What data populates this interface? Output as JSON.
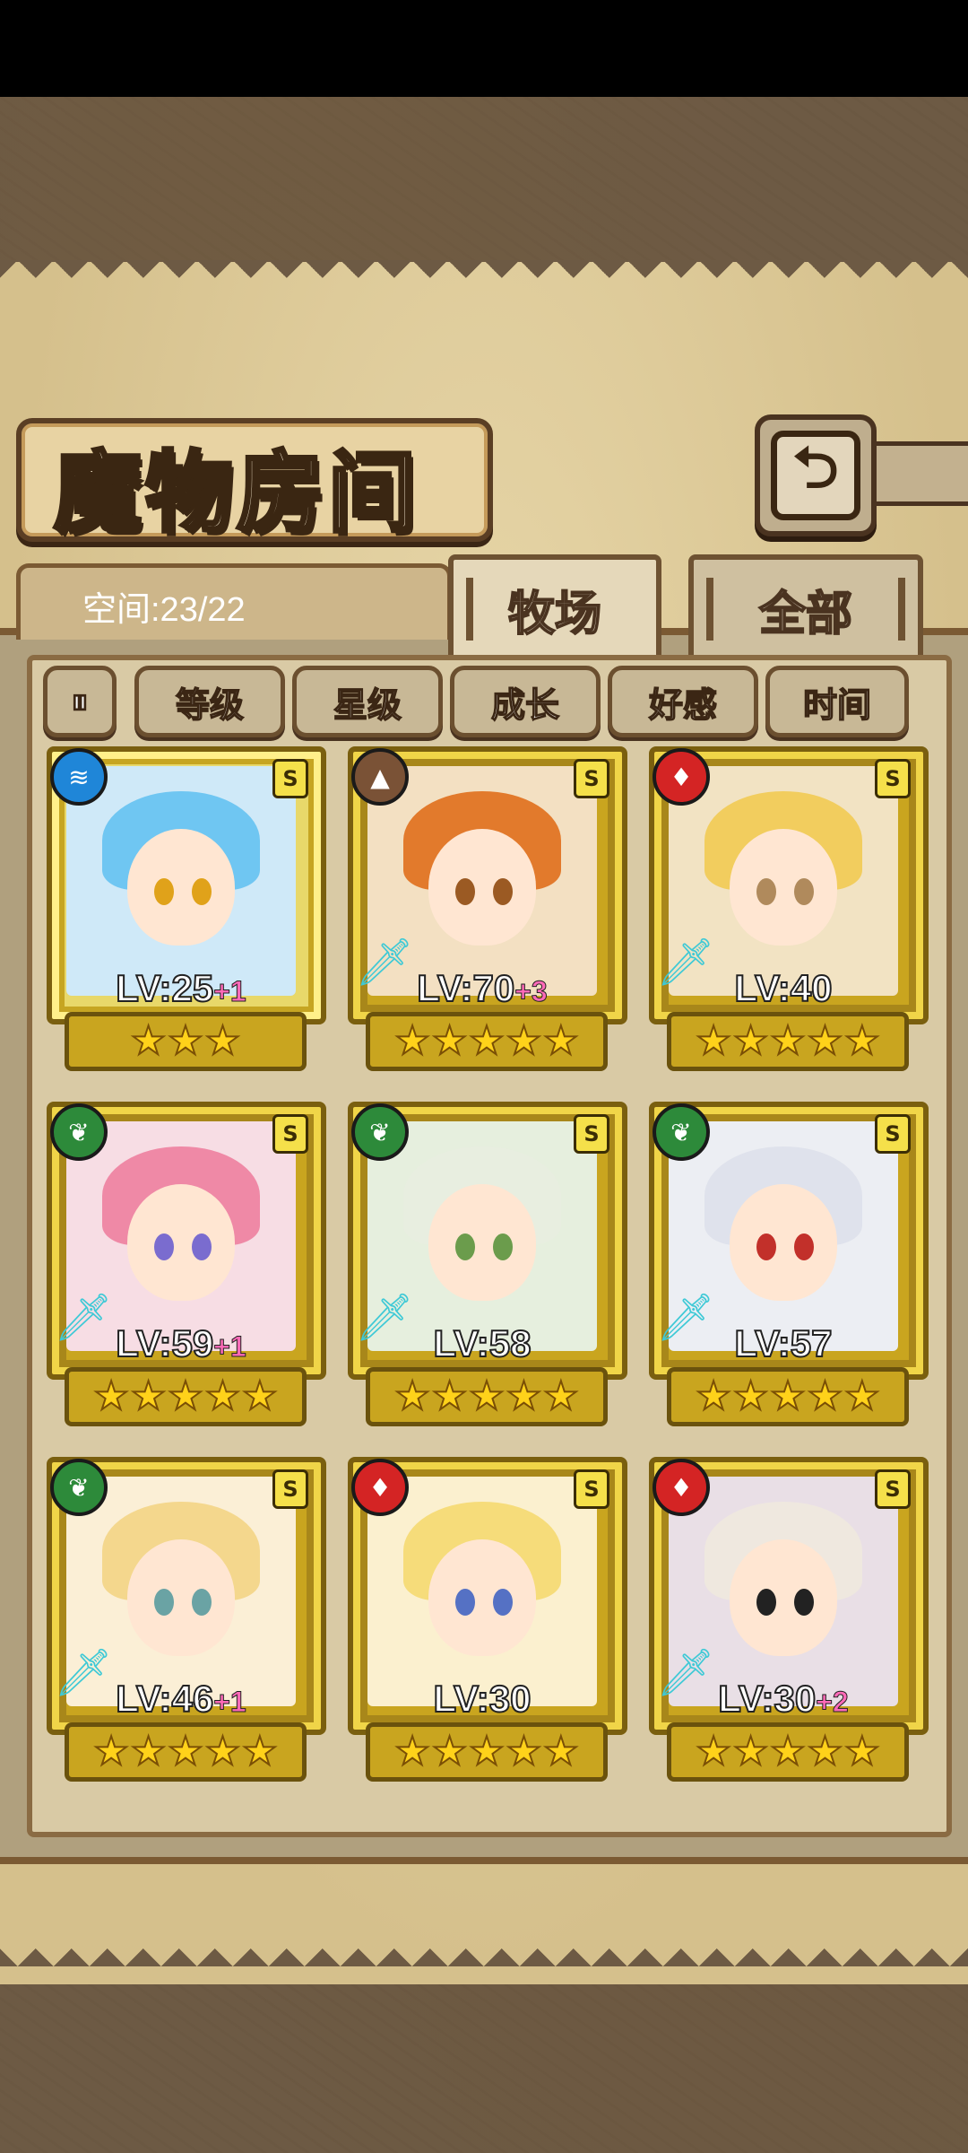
{
  "title": "魔物房间",
  "back_icon": "⮌",
  "space": {
    "label": "空间:23/22"
  },
  "tabs": [
    {
      "label": "牧场",
      "active": true
    },
    {
      "label": "全部",
      "active": false
    }
  ],
  "sort_toggle_icon": "⏸",
  "filters": [
    "等级",
    "星级",
    "成长",
    "好感",
    "时间"
  ],
  "colors": {
    "water": "#1f86d8",
    "earth": "#7a5236",
    "fire": "#d42424",
    "nature": "#2d8a3a"
  },
  "monsters": [
    {
      "element": "water",
      "element_icon": "≋",
      "rank": "S",
      "level": "LV:25",
      "bonus": "+1",
      "stars": 3,
      "selected": true,
      "weapon": false,
      "hair": "#6fc6f2",
      "eye": "#e0a21a",
      "bg": "#cfe9f8"
    },
    {
      "element": "earth",
      "element_icon": "▲",
      "rank": "S",
      "level": "LV:70",
      "bonus": "+3",
      "stars": 5,
      "selected": false,
      "weapon": true,
      "hair": "#e27a2c",
      "eye": "#9b5a23",
      "bg": "#f3e0c2"
    },
    {
      "element": "fire",
      "element_icon": "♦",
      "rank": "S",
      "level": "LV:40",
      "bonus": "",
      "stars": 5,
      "selected": false,
      "weapon": true,
      "hair": "#f2cd5e",
      "eye": "#b08a5c",
      "bg": "#f2e3c3"
    },
    {
      "element": "nature",
      "element_icon": "❦",
      "rank": "S",
      "level": "LV:59",
      "bonus": "+1",
      "stars": 5,
      "selected": false,
      "weapon": true,
      "hair": "#ef89a6",
      "eye": "#7a6ccf",
      "bg": "#f7dde4"
    },
    {
      "element": "nature",
      "element_icon": "❦",
      "rank": "S",
      "level": "LV:58",
      "bonus": "",
      "stars": 5,
      "selected": false,
      "weapon": true,
      "hair": "#e8eee0",
      "eye": "#6b9c4c",
      "bg": "#e6efde"
    },
    {
      "element": "nature",
      "element_icon": "❦",
      "rank": "S",
      "level": "LV:57",
      "bonus": "",
      "stars": 5,
      "selected": false,
      "weapon": true,
      "hair": "#dfe2ec",
      "eye": "#c2302a",
      "bg": "#eceef3"
    },
    {
      "element": "nature",
      "element_icon": "❦",
      "rank": "S",
      "level": "LV:46",
      "bonus": "+1",
      "stars": 5,
      "selected": false,
      "weapon": true,
      "hair": "#f4d78d",
      "eye": "#6aa3a4",
      "bg": "#fbefd6"
    },
    {
      "element": "fire",
      "element_icon": "♦",
      "rank": "S",
      "level": "LV:30",
      "bonus": "",
      "stars": 5,
      "selected": false,
      "weapon": false,
      "hair": "#f6dc7a",
      "eye": "#5571c4",
      "bg": "#fbf0cf"
    },
    {
      "element": "fire",
      "element_icon": "♦",
      "rank": "S",
      "level": "LV:30",
      "bonus": "+2",
      "stars": 5,
      "selected": false,
      "weapon": true,
      "hair": "#efe8df",
      "eye": "#222222",
      "bg": "#e9dfe6"
    }
  ]
}
